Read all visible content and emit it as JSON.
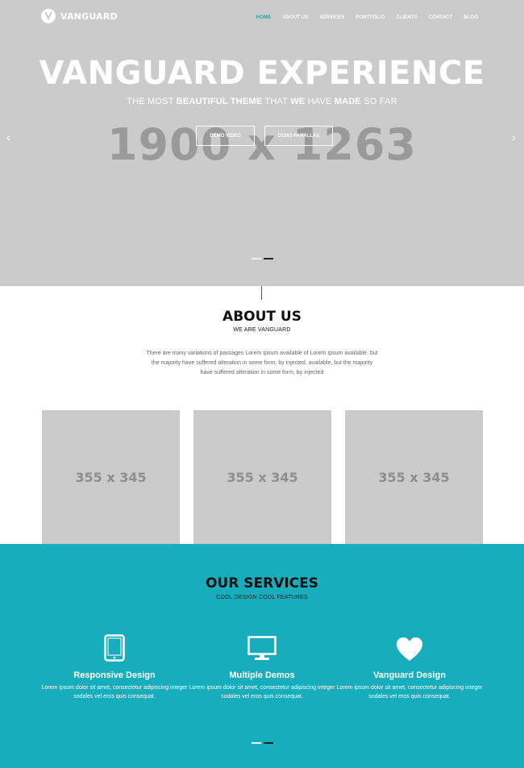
{
  "brand": {
    "name": "VANGUARD",
    "accent": "#1aa9b8"
  },
  "nav": {
    "items": [
      {
        "label": "HOME",
        "active": true
      },
      {
        "label": "ABOUT US",
        "active": false
      },
      {
        "label": "SERVICES",
        "active": false
      },
      {
        "label": "PORTFOLIO",
        "active": false
      },
      {
        "label": "CLIENTS",
        "active": false
      },
      {
        "label": "CONTACT",
        "active": false
      },
      {
        "label": "BLOG",
        "active": false
      }
    ]
  },
  "hero": {
    "title": "VANGUARD EXPERIENCE",
    "subtitle": {
      "p1": "THE MOST ",
      "b1": "BEAUTIFUL THEME",
      "p2": " THAT ",
      "b2": "WE",
      "p3": " HAVE ",
      "b3": "MADE",
      "p4": " SO FAR"
    },
    "placeholder": "1900 x 1263",
    "buttons": {
      "video": "DEMO VIDEO",
      "parallax": "DEMO PARALLAX"
    },
    "arrows": {
      "left": "‹",
      "right": "›",
      "icon_left": "chevron-left-icon",
      "icon_right": "chevron-right-icon"
    },
    "slides": 2,
    "active_slide": 2
  },
  "about": {
    "title": "ABOUT US",
    "subtitle": "WE ARE VANGUARD",
    "text": "There are many variations of passages Lorem Ipsum available of Lorem Ipsum available, but the majority have suffered alteration in some form, by injected. available, but the majority have suffered alteration in some form, by injected",
    "images": [
      "355 x 345",
      "355 x 345",
      "355 x 345"
    ]
  },
  "services": {
    "bg_color": "#18adbc",
    "title": "OUR SERVICES",
    "subtitle": "COOL DESIGN COOL FEATURES",
    "items": [
      {
        "icon": "tablet-icon",
        "title": "Responsive Design",
        "text": "Lorem ipsum dolor sit amet, consectetur adipiscing integer sodales vel eros quis consequat."
      },
      {
        "icon": "monitor-icon",
        "title": "Multiple Demos",
        "text": "Lorem ipsum dolor sit amet, consectetur adipiscing integer sodales vel eros quis consequat."
      },
      {
        "icon": "heart-icon",
        "title": "Vanguard Design",
        "text": "Lorem ipsum dolor sit amet, consectetur adipiscing integer sodales vel eros quis consequat."
      }
    ],
    "slides": 2,
    "active_slide": 2
  }
}
